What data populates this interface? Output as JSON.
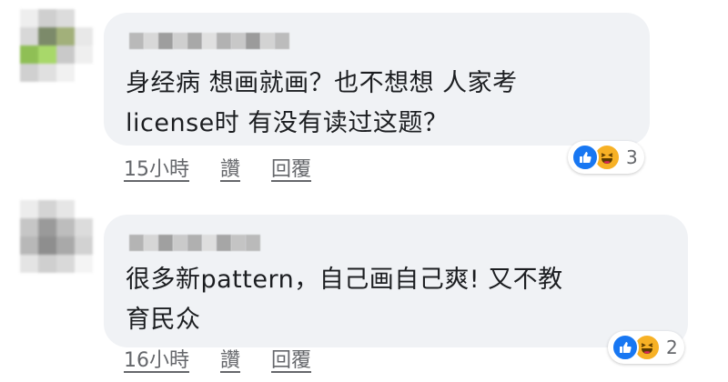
{
  "comments": [
    {
      "author_pixels": [
        "#b9b9b9",
        "#d8d8d8",
        "#9e9e9e",
        "#cfcfcf",
        "#a8a8a8",
        "#e0e0e0",
        "#b2b2b2",
        "#c8c8c8",
        "#9b9b9b",
        "#d3d3d3",
        "#bcbcbc"
      ],
      "avatar_pixels": [
        "#eeeeee",
        "#cfcfcf",
        "#dcdcdc",
        "#ffffff",
        "#d8d8d8",
        "#7c8a6a",
        "#a2b07a",
        "#e8e8e8",
        "#8fbf55",
        "#a8d86a",
        "#c9c9c9",
        "#efefef",
        "#d0d0d0",
        "#e0e0e0",
        "#f1f1f1",
        "#ffffff"
      ],
      "text": "身经病 想画就画？也不想想 人家考\nlicense时 有没有读过这题？",
      "time": "15小時",
      "like_label": "讚",
      "reply_label": "回覆",
      "reaction_count": "3"
    },
    {
      "author_pixels": [
        "#b4b4b4",
        "#d6d6d6",
        "#a0a0a0",
        "#cacaca",
        "#b0b0b0",
        "#dedede",
        "#a6a6a6",
        "#c4c4c4",
        "#bababa"
      ],
      "avatar_pixels": [
        "#ececec",
        "#d4d4d4",
        "#e6e6e6",
        "#ffffff",
        "#c6c6c6",
        "#9a9a9a",
        "#bdbdbd",
        "#dcdcdc",
        "#b8b8b8",
        "#8e8e8e",
        "#a9a9a9",
        "#d2d2d2",
        "#e4e4e4",
        "#cfcfcf",
        "#d9d9d9",
        "#f4f4f4"
      ],
      "text": "很多新pattern，自己画自己爽! 又不教\n育民众",
      "time": "16小時",
      "like_label": "讚",
      "reply_label": "回覆",
      "reaction_count": "2"
    }
  ],
  "colors": {
    "bubble": "#f0f2f5",
    "text": "#1c1e21",
    "meta": "#65676b",
    "like_reaction": "#1877f2",
    "haha_reaction": "#f7b125"
  },
  "icons": [
    "like-reaction-icon",
    "haha-reaction-icon"
  ]
}
